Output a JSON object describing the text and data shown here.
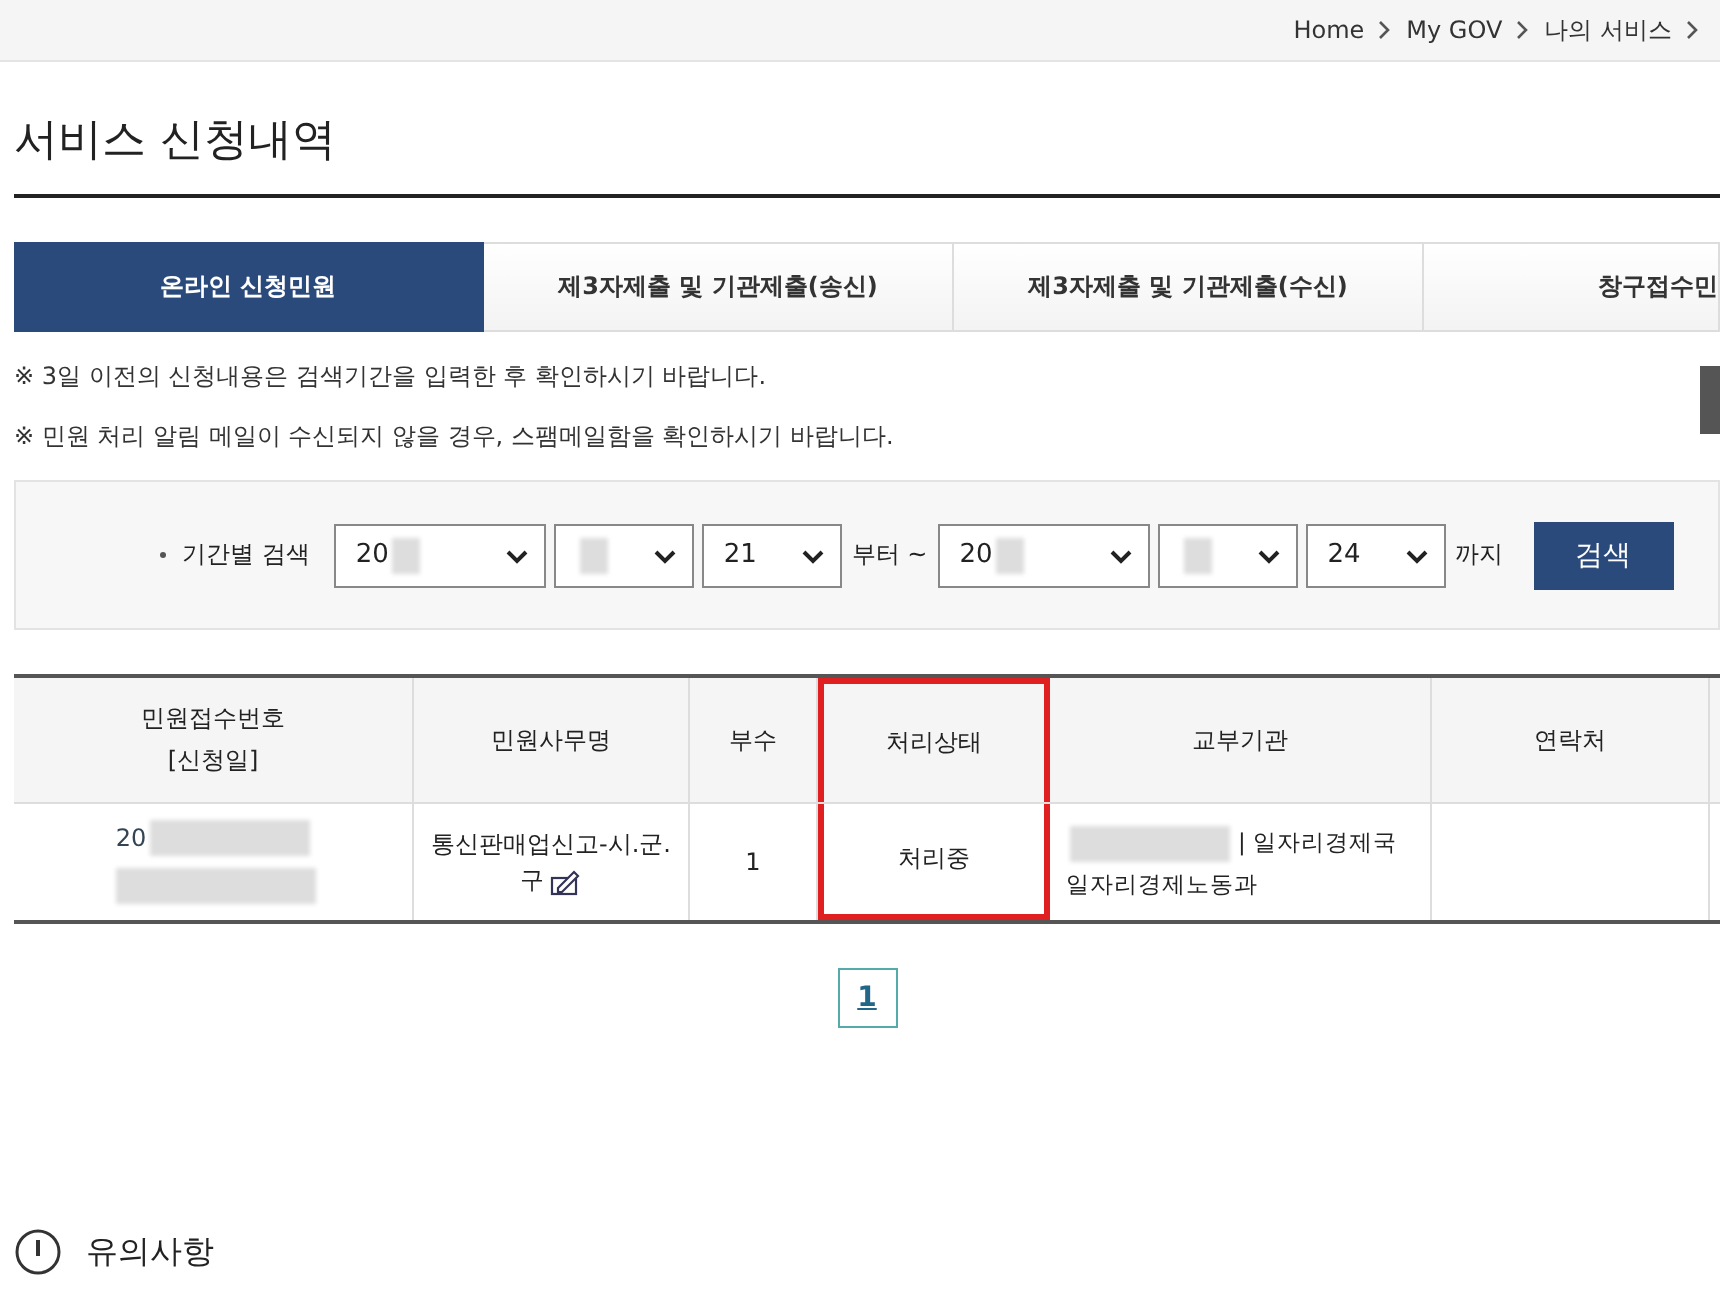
{
  "breadcrumb": [
    {
      "label": "Home"
    },
    {
      "label": "My GOV"
    },
    {
      "label": "나의 서비스"
    }
  ],
  "page_title": "서비스 신청내역",
  "tabs": [
    {
      "label": "온라인 신청민원",
      "selected": true
    },
    {
      "label": "제3자제출 및 기관제출(송신)",
      "selected": false
    },
    {
      "label": "제3자제출 및 기관제출(수신)",
      "selected": false
    },
    {
      "label": "창구접수민",
      "selected": false
    }
  ],
  "notices": [
    "※ 3일 이전의 신청내용은 검색기간을 입력한 후 확인하시기 바랍니다.",
    "※ 민원 처리 알림 메일이 수신되지 않을 경우, 스팸메일함을 확인하시기 바랍니다."
  ],
  "search": {
    "label": "기간별 검색",
    "from": [
      {
        "value": "20",
        "redacted": true
      },
      {
        "redacted": true
      },
      {
        "value": "21",
        "redacted": false
      }
    ],
    "from_suffix": "부터 ~",
    "to": [
      {
        "value": "20",
        "redacted": true
      },
      {
        "redacted": true
      },
      {
        "value": "24",
        "redacted": false
      }
    ],
    "to_suffix": "까지",
    "button": "검색"
  },
  "table": {
    "columns": [
      {
        "label": "민원접수번호",
        "sub": "[신청일]",
        "highlighted": false
      },
      {
        "label": "민원사무명",
        "highlighted": false
      },
      {
        "label": "부수",
        "highlighted": false
      },
      {
        "label": "처리상태",
        "highlighted": true
      },
      {
        "label": "교부기관",
        "highlighted": false
      },
      {
        "label": "연락처",
        "highlighted": false
      }
    ],
    "rows": [
      {
        "number": "20",
        "service": "통신판매업신고-시.군.구",
        "copies": "1",
        "status": "처리중",
        "agency_1": "| 일자리경제국",
        "agency_2": "일자리경제노동과",
        "contact": ""
      }
    ]
  },
  "pagination": [
    {
      "label": "1",
      "selected": true
    }
  ],
  "caution_title": "유의사항"
}
